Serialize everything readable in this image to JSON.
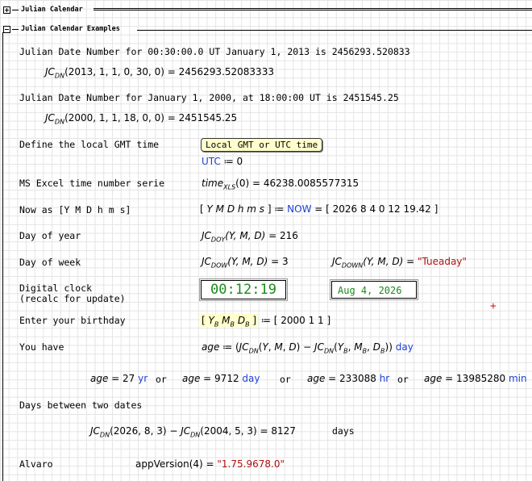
{
  "regions": {
    "collapsed_title": "Julian Calendar",
    "expanded_title": "Julian Calendar Examples"
  },
  "rows": {
    "jd1_text": "Julian Date Number for 00:30:00.0 UT January 1, 2013 is 2456293.520833",
    "jd1_args": "(2013, 1, 1, 0, 30, 0)",
    "jd1_result": "2456293.52083333",
    "jd2_text": "Julian Date Number for January 1, 2000, at 18:00:00 UT is 2451545.25",
    "jd2_args": "(2000, 1, 1, 18, 0, 0)",
    "jd2_result": "2451545.25",
    "gmt_label": "Define the local GMT time",
    "gmt_button": "Local GMT or UTC time",
    "utc_name": "UTC",
    "utc_value": "0",
    "excel_label": "MS Excel time number serie",
    "excel_fn": "time",
    "excel_sub": "XLS",
    "excel_args": "(0)",
    "excel_value": "46238.0085577315",
    "now_label": "Now as [Y M D h m s]",
    "now_vector": "Y M D h m s",
    "now_fn": "NOW",
    "now_result": "2026 8 4 0 12 19.42",
    "doy_label": "Day of year",
    "doy_sub": "DOY",
    "doy_args": "(Y, M, D)",
    "doy_value": "216",
    "dow_label": "Day of week",
    "dow_sub": "DOW",
    "dow_args": "(Y, M, D)",
    "dow_value": "3",
    "down_sub": "DOWN",
    "down_args": "(Y, M, D)",
    "down_value": "\"Tueaday\"",
    "clock_label_1": "Digital clock",
    "clock_label_2": "(recalc for update)",
    "clock_time": "00:12:19",
    "clock_date": "Aug 4, 2026",
    "birth_label": "Enter your birthday",
    "birth_result": "2000 1 1",
    "have_label": "You have",
    "have_unit": "day",
    "age_yr": "27",
    "age_day": "9712",
    "age_hr": "233088",
    "age_min": "13985280",
    "unit_yr": "yr",
    "unit_day": "day",
    "unit_hr": "hr",
    "unit_min": "min",
    "or_word": "or",
    "between_label": "Days between two dates",
    "between_a": "(2026, 8, 3)",
    "between_b": "(2004, 5, 3)",
    "between_value": "8127",
    "between_unit": "days",
    "author": "Alvaro",
    "version_fn": "appVersion",
    "version_args": "(4)",
    "version_value": "\"1.75.9678.0\""
  },
  "colors": {
    "variable": "#1f3fd6",
    "string": "#b01010",
    "clock": "#1a8a1a",
    "button_bg": "#ffffcc",
    "crosshair": "#e02020"
  }
}
